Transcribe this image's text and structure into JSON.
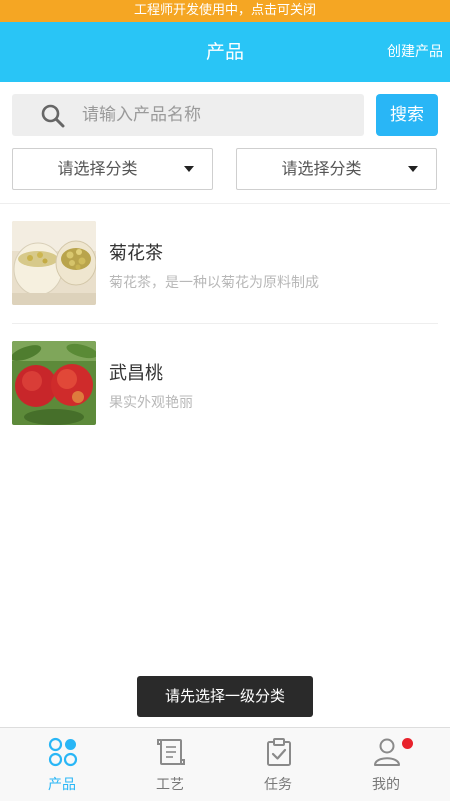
{
  "dev_banner": "工程师开发使用中，点击可关闭",
  "nav": {
    "title": "产品",
    "action": "创建产品"
  },
  "search": {
    "placeholder": "请输入产品名称",
    "value": "",
    "button": "搜索",
    "icon": "search-icon"
  },
  "filters": [
    {
      "label": "请选择分类"
    },
    {
      "label": "请选择分类"
    }
  ],
  "products": [
    {
      "name": "菊花茶",
      "desc": "菊花茶，是一种以菊花为原料制成",
      "image": "chrysanthemum-tea-photo"
    },
    {
      "name": "武昌桃",
      "desc": "果实外观艳丽",
      "image": "peach-photo"
    }
  ],
  "toast": "请先选择一级分类",
  "tabs": [
    {
      "label": "产品",
      "icon": "clover-icon",
      "active": true
    },
    {
      "label": "工艺",
      "icon": "scroll-icon",
      "active": false
    },
    {
      "label": "任务",
      "icon": "clipboard-check-icon",
      "active": false
    },
    {
      "label": "我的",
      "icon": "user-icon",
      "active": false,
      "badge_dot": true
    }
  ],
  "colors": {
    "banner": "#f5a623",
    "primary": "#29c5f6",
    "button": "#29b6f6",
    "badge": "#e8222c"
  }
}
